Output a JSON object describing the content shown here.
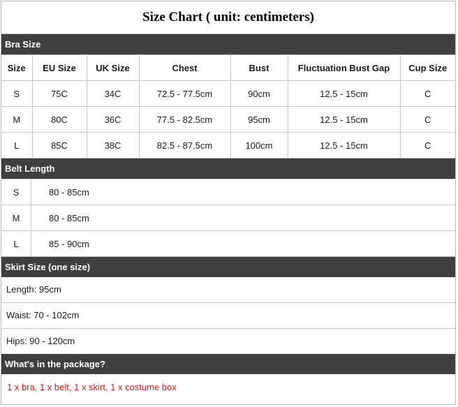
{
  "title": "Size Chart ( unit: centimeters)",
  "bra": {
    "section_label": "Bra Size",
    "headers": [
      "Size",
      "EU Size",
      "UK Size",
      "Chest",
      "Bust",
      "Fluctuation Bust Gap",
      "Cup Size"
    ],
    "rows": [
      [
        "S",
        "75C",
        "34C",
        "72.5 - 77.5cm",
        "90cm",
        "12.5 - 15cm",
        "C"
      ],
      [
        "M",
        "80C",
        "36C",
        "77.5 - 82.5cm",
        "95cm",
        "12.5 - 15cm",
        "C"
      ],
      [
        "L",
        "85C",
        "38C",
        "82.5 - 87.5cm",
        "100cm",
        "12.5 - 15cm",
        "C"
      ]
    ]
  },
  "belt": {
    "section_label": "Belt Length",
    "rows": [
      {
        "size": "S",
        "value": "80 - 85cm"
      },
      {
        "size": "M",
        "value": "80 - 85cm"
      },
      {
        "size": "L",
        "value": "85 - 90cm"
      }
    ]
  },
  "skirt": {
    "section_label": "Skirt Size (one size)",
    "length": "Length: 95cm",
    "waist": "Waist: 70 - 102cm",
    "hips": "Hips: 90 - 120cm"
  },
  "package": {
    "section_label": "What's in the package?",
    "contents": "1 x bra, 1 x belt, 1 x skirt, 1 x costume box",
    "text_color": "#d8171b"
  },
  "colors": {
    "section_bar": "#3f3f3f",
    "grid_line": "#c4c4c4"
  }
}
